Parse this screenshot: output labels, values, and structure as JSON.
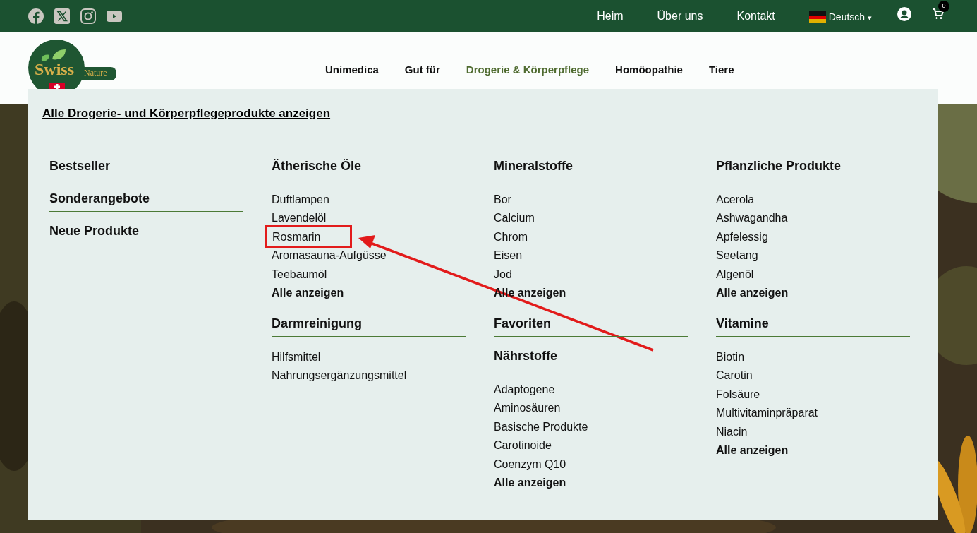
{
  "topbar": {
    "social": [
      {
        "kind": "facebook"
      },
      {
        "kind": "x"
      },
      {
        "kind": "instagram"
      },
      {
        "kind": "youtube"
      }
    ],
    "links": [
      "Heim",
      "Über uns",
      "Kontakt"
    ],
    "language": "Deutsch",
    "caret": "▾",
    "cart_count": "0"
  },
  "logo": {
    "word": "Swiss",
    "tag": "Nature"
  },
  "nav": [
    {
      "label": "Unimedica",
      "selected": false
    },
    {
      "label": "Gut für",
      "selected": false
    },
    {
      "label": "Drogerie & Körperpflege",
      "selected": true
    },
    {
      "label": "Homöopathie",
      "selected": false
    },
    {
      "label": "Tiere",
      "selected": false
    }
  ],
  "mega_menu": {
    "all_link": "Alle Drogerie- und Körperpflegeprodukte anzeigen",
    "columns": [
      [
        {
          "title": "Bestseller"
        },
        {
          "title": "Sonderangebote"
        },
        {
          "title": "Neue Produkte"
        }
      ],
      [
        {
          "title": "Ätherische Öle",
          "items": [
            {
              "label": "Duftlampen",
              "highlighted": false
            },
            {
              "label": "Lavendelöl",
              "highlighted": false
            },
            {
              "label": "Rosmarin",
              "highlighted": true
            },
            {
              "label": "Aromasauna-Aufgüsse",
              "highlighted": false
            },
            {
              "label": "Teebaumöl",
              "highlighted": false
            }
          ],
          "more": "Alle anzeigen"
        },
        {
          "title": "Darmreinigung",
          "items": [
            {
              "label": "Hilfsmittel",
              "highlighted": false
            },
            {
              "label": "Nahrungsergänzungsmittel",
              "highlighted": false
            }
          ]
        }
      ],
      [
        {
          "title": "Mineralstoffe",
          "items": [
            {
              "label": "Bor",
              "highlighted": false
            },
            {
              "label": "Calcium",
              "highlighted": false
            },
            {
              "label": "Chrom",
              "highlighted": false
            },
            {
              "label": "Eisen",
              "highlighted": false
            },
            {
              "label": "Jod",
              "highlighted": false
            }
          ],
          "more": "Alle anzeigen"
        },
        {
          "title": "Favoriten"
        },
        {
          "title": "Nährstoffe",
          "items": [
            {
              "label": "Adaptogene",
              "highlighted": false
            },
            {
              "label": "Aminosäuren",
              "highlighted": false
            },
            {
              "label": "Basische Produkte",
              "highlighted": false
            },
            {
              "label": "Carotinoide",
              "highlighted": false
            },
            {
              "label": "Coenzym Q10",
              "highlighted": false
            }
          ],
          "more": "Alle anzeigen"
        }
      ],
      [
        {
          "title": "Pflanzliche Produkte",
          "items": [
            {
              "label": "Acerola",
              "highlighted": false
            },
            {
              "label": "Ashwagandha",
              "highlighted": false
            },
            {
              "label": "Apfelessig",
              "highlighted": false
            },
            {
              "label": "Seetang",
              "highlighted": false
            },
            {
              "label": "Algenöl",
              "highlighted": false
            }
          ],
          "more": "Alle anzeigen"
        },
        {
          "title": "Vitamine",
          "items": [
            {
              "label": "Biotin",
              "highlighted": false
            },
            {
              "label": "Carotin",
              "highlighted": false
            },
            {
              "label": "Folsäure",
              "highlighted": false
            },
            {
              "label": "Multivitaminpräparat",
              "highlighted": false
            },
            {
              "label": "Niacin",
              "highlighted": false
            }
          ],
          "more": "Alle anzeigen"
        }
      ]
    ]
  },
  "annotation": {
    "kind": "arrow"
  }
}
